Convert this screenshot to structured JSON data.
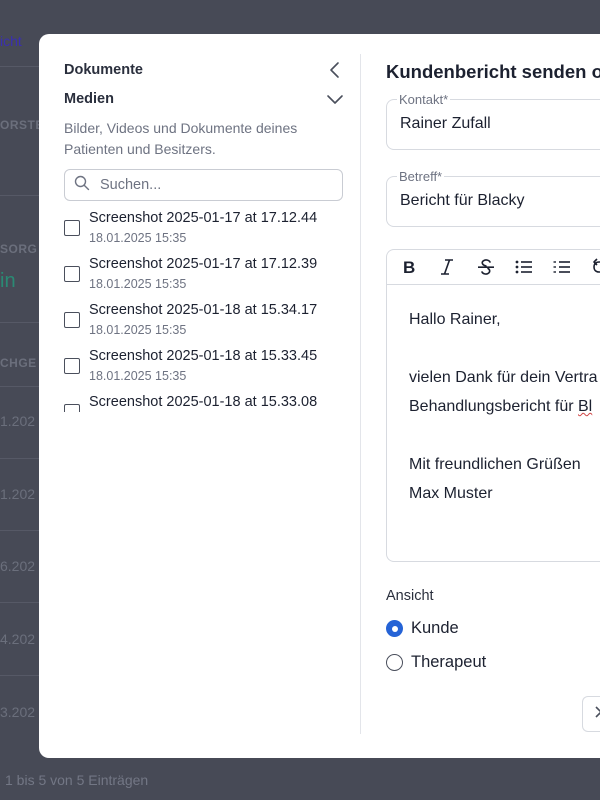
{
  "background": {
    "link_text": "icht",
    "col_header_1": "ORSTE",
    "col_header_2": "SORG",
    "status_text": "in",
    "col_header_3": "CHGE",
    "rows": [
      "1.202",
      "1.202",
      "6.202",
      "4.202",
      "3.202"
    ],
    "footer": "1 bis 5 von 5 Einträgen"
  },
  "left_panel": {
    "documents_label": "Dokumente",
    "media_label": "Medien",
    "description": "Bilder, Videos und Dokumente deines Patienten und Besitzers.",
    "search_placeholder": "Suchen...",
    "files": [
      {
        "name": "Screenshot 2025-01-17 at 17.12.44",
        "date": "18.01.2025 15:35"
      },
      {
        "name": "Screenshot 2025-01-17 at 17.12.39",
        "date": "18.01.2025 15:35"
      },
      {
        "name": "Screenshot 2025-01-18 at 15.34.17",
        "date": "18.01.2025 15:35"
      },
      {
        "name": "Screenshot 2025-01-18 at 15.33.45",
        "date": "18.01.2025 15:35"
      },
      {
        "name": "Screenshot 2025-01-18 at 15.33.08",
        "date": ""
      }
    ]
  },
  "right_panel": {
    "title": "Kundenbericht senden o",
    "contact_label": "Kontakt*",
    "contact_value": "Rainer Zufall",
    "subject_label": "Betreff*",
    "subject_value": "Bericht für Blacky",
    "toolbar_icons": [
      "bold-icon",
      "italic-icon",
      "strikethrough-icon",
      "bullet-list-icon",
      "numbered-list-icon",
      "undo-icon"
    ],
    "editor": {
      "greeting": "Hallo Rainer,",
      "line1": "vielen Dank für dein Vertra",
      "line2_prefix": "Behandlungsbericht für ",
      "line2_flagged": "Bl",
      "closing": "Mit freundlichen Grüßen",
      "signature": "Max Muster"
    },
    "view_label": "Ansicht",
    "view_options": [
      {
        "label": "Kunde",
        "selected": true
      },
      {
        "label": "Therapeut",
        "selected": false
      }
    ]
  },
  "colors": {
    "accent": "#2563d6",
    "overlay": "#474a56",
    "spellcheck": "#d04545"
  }
}
